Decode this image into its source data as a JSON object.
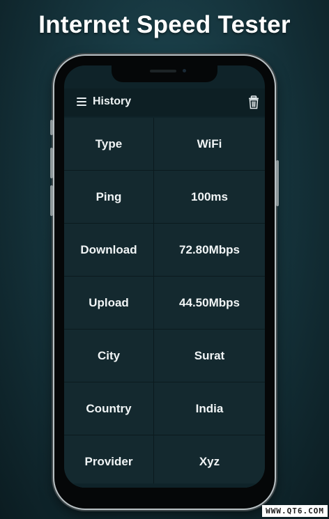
{
  "promo": {
    "title": "Internet Speed Tester"
  },
  "appbar": {
    "title": "History",
    "menu_icon": "hamburger-menu-icon",
    "delete_icon": "trash-icon"
  },
  "history": {
    "rows": [
      {
        "label": "Type",
        "value": "WiFi"
      },
      {
        "label": "Ping",
        "value": "100ms"
      },
      {
        "label": "Download",
        "value": "72.80Mbps"
      },
      {
        "label": "Upload",
        "value": "44.50Mbps"
      },
      {
        "label": "City",
        "value": "Surat"
      },
      {
        "label": "Country",
        "value": "India"
      },
      {
        "label": "Provider",
        "value": "Xyz"
      }
    ]
  },
  "watermark": {
    "text": "WWW.QT6.COM"
  },
  "colors": {
    "background": "#143139",
    "screen": "#0f2329",
    "cell": "#14292f",
    "text": "#f1f5f6"
  }
}
